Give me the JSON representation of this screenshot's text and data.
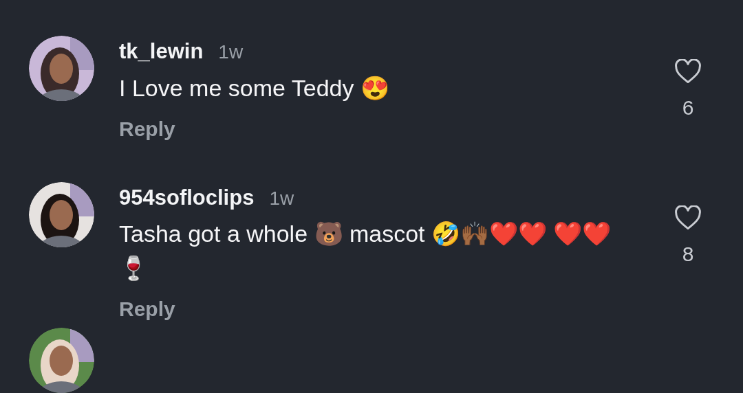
{
  "comments": [
    {
      "username": "tk_lewin",
      "time": "1w",
      "text": "I Love me some Teddy 😍",
      "reply": "Reply",
      "likes": "6",
      "liked": false
    },
    {
      "username": "954sofloclips",
      "time": "1w",
      "text": "Tasha got a whole 🐻 mascot 🤣🙌🏾❤️❤️ ❤️❤️ 🍷",
      "reply": "Reply",
      "likes": "8",
      "liked": false
    },
    {
      "kind": "picture"
    }
  ]
}
